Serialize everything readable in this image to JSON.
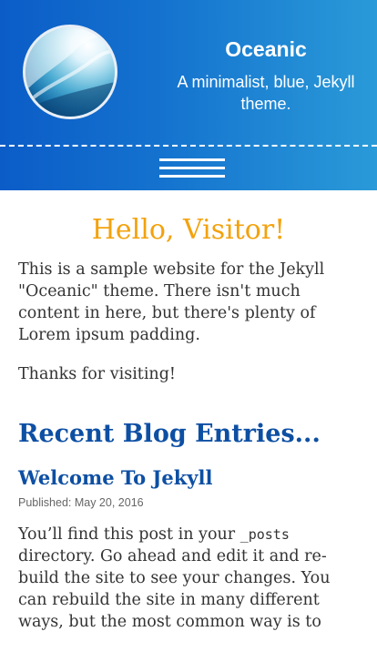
{
  "header": {
    "site_title": "Oceanic",
    "tagline": "A minimalist, blue, Jekyll theme.",
    "avatar_icon": "ocean-wave-icon",
    "menu_icon": "hamburger-menu-icon",
    "colors": {
      "gradient_start": "#0b5cc7",
      "gradient_end": "#2a9ad8"
    }
  },
  "main": {
    "greeting": "Hello, Visitor!",
    "intro": "This is a sample website for the Jekyll \"Oceanic\" theme. There isn't much content in here, but there's plenty of Lorem ipsum padding.",
    "thanks": "Thanks for visiting!",
    "section_heading": "Recent Blog Entries...",
    "colors": {
      "greeting": "#f3a20d",
      "heading": "#0d4fa3"
    }
  },
  "posts": [
    {
      "title": "Welcome To Jekyll",
      "meta": "Published: May 20, 2016",
      "excerpt_before": "You’ll find this post in your ",
      "excerpt_code": "_posts",
      "excerpt_after": " directory. Go ahead and edit it and re-build the site to see your changes. You can rebuild the site in many different ways, but the most common way is to"
    }
  ]
}
